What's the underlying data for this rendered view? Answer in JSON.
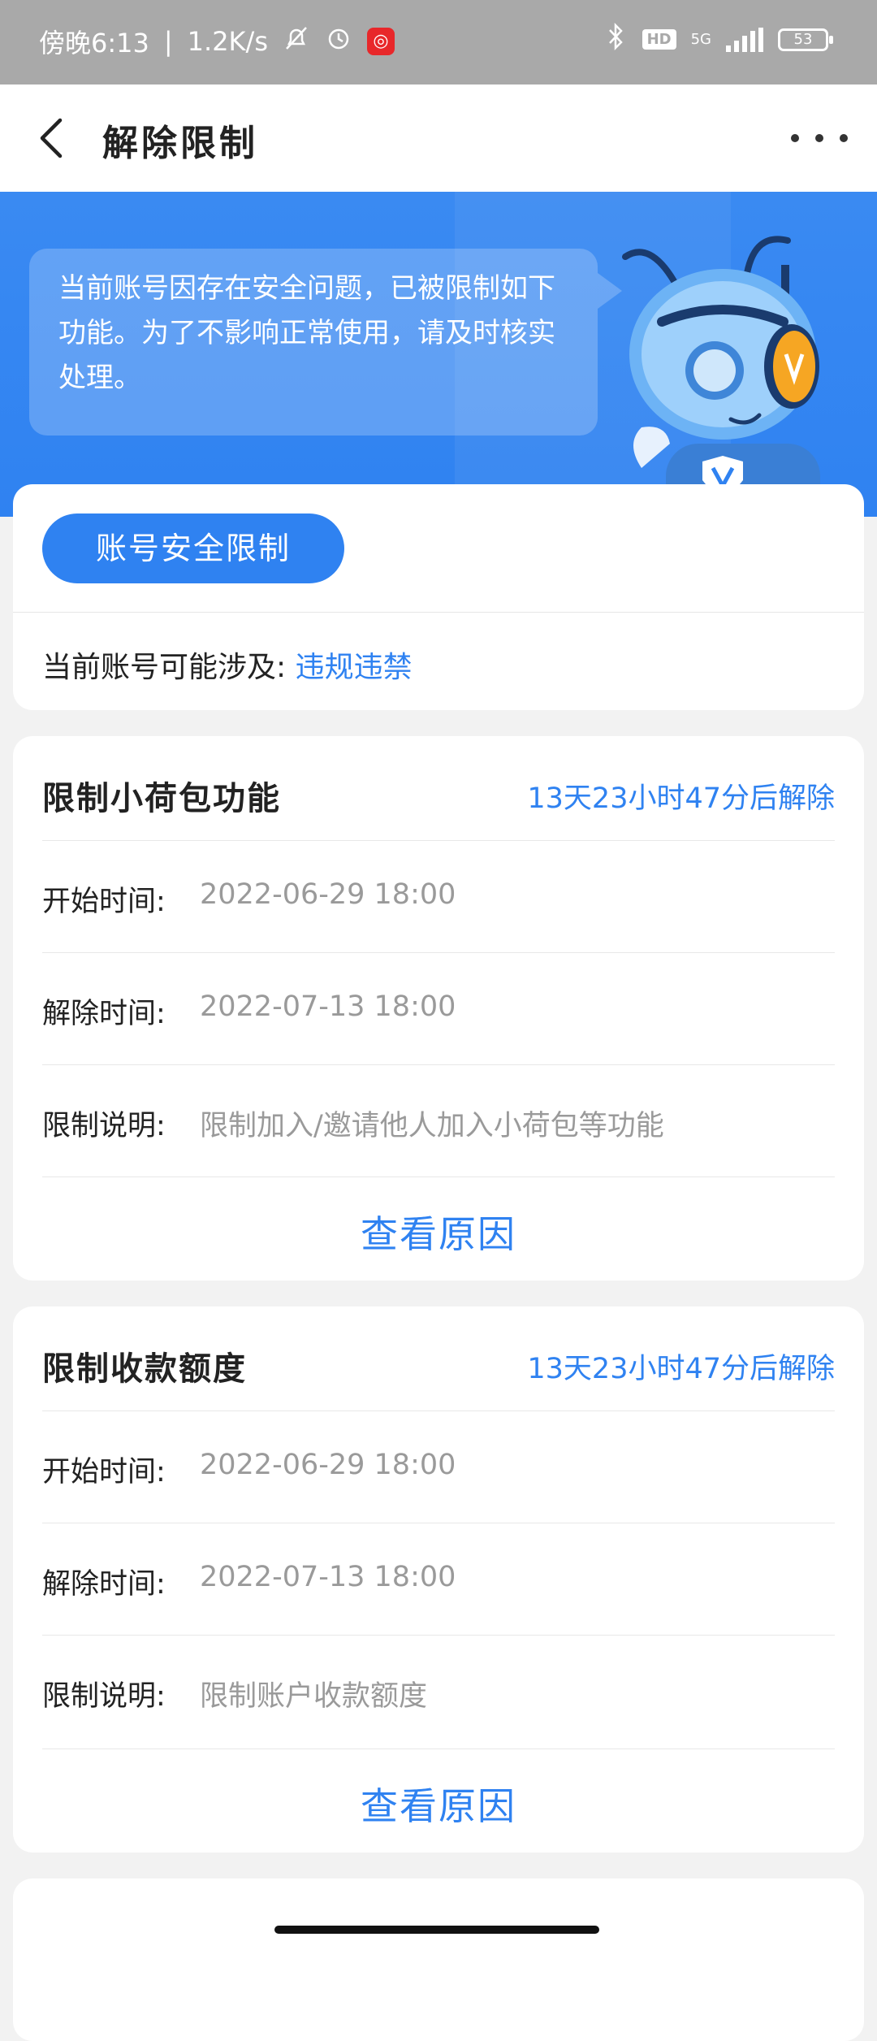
{
  "status_bar": {
    "time": "傍晚6:13",
    "speed": "1.2K/s",
    "hd": "HD",
    "net": "5G",
    "battery": "53"
  },
  "header": {
    "title": "解除限制"
  },
  "banner": {
    "message": "当前账号因存在安全问题，已被限制如下功能。为了不影响正常使用，请及时核实处理。"
  },
  "account": {
    "button_label": "账号安全限制",
    "involves_label": "当前账号可能涉及:",
    "involves_link": "违规违禁"
  },
  "restrictions": [
    {
      "title": "限制小荷包功能",
      "countdown": "13天23小时47分后解除",
      "start_label": "开始时间:",
      "start_value": "2022-06-29 18:00",
      "end_label": "解除时间:",
      "end_value": "2022-07-13 18:00",
      "desc_label": "限制说明:",
      "desc_value": "限制加入/邀请他人加入小荷包等功能",
      "link": "查看原因"
    },
    {
      "title": "限制收款额度",
      "countdown": "13天23小时47分后解除",
      "start_label": "开始时间:",
      "start_value": "2022-06-29 18:00",
      "end_label": "解除时间:",
      "end_value": "2022-07-13 18:00",
      "desc_label": "限制说明:",
      "desc_value": "限制账户收款额度",
      "link": "查看原因"
    }
  ],
  "colors": {
    "brand": "#2f82f1",
    "status_bar": "#a9a9a9"
  }
}
